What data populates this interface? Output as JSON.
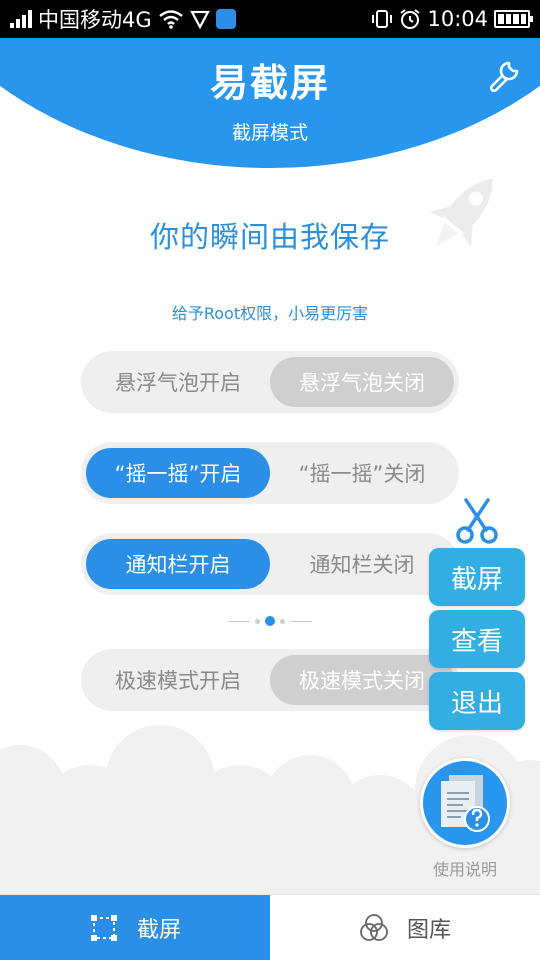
{
  "status_bar": {
    "carrier": "中国移动4G",
    "time": "10:04",
    "icons": [
      "signal-icon",
      "wifi-icon",
      "vpn-shield-icon",
      "app-notification-icon",
      "vibrate-icon",
      "alarm-icon",
      "battery-icon"
    ]
  },
  "header": {
    "title": "易截屏",
    "subtitle": "截屏模式",
    "settings_icon": "wrench-icon"
  },
  "hero": {
    "tagline": "你的瞬间由我保存",
    "root_hint": "给予Root权限，小易更厉害",
    "decoration_icon": "rocket-icon"
  },
  "toggles": {
    "float_bubble": {
      "on_label": "悬浮气泡开启",
      "off_label": "悬浮气泡关闭",
      "selected": "off"
    },
    "shake": {
      "on_label": "“摇一摇”开启",
      "off_label": "“摇一摇”关闭",
      "selected": "on"
    },
    "notification": {
      "on_label": "通知栏开启",
      "off_label": "通知栏关闭",
      "selected": "on"
    },
    "speed_mode": {
      "on_label": "极速模式开启",
      "off_label": "极速模式关闭",
      "selected": "off"
    }
  },
  "pager": {
    "current_page": 2,
    "total_pages": 3
  },
  "float_menu": {
    "capture_label": "截屏",
    "view_label": "查看",
    "exit_label": "退出",
    "icon": "scissors-icon"
  },
  "help": {
    "label": "使用说明",
    "icon": "document-help-icon"
  },
  "bottom_nav": {
    "tabs": [
      {
        "label": "截屏",
        "icon": "screenshot-frame-icon",
        "active": true
      },
      {
        "label": "图库",
        "icon": "gallery-circles-icon",
        "active": false
      }
    ]
  },
  "colors": {
    "primary": "#2796ec",
    "float_button": "#33aee3",
    "toggle_track": "#efefef",
    "toggle_off_selected": "#cfcfcf"
  }
}
